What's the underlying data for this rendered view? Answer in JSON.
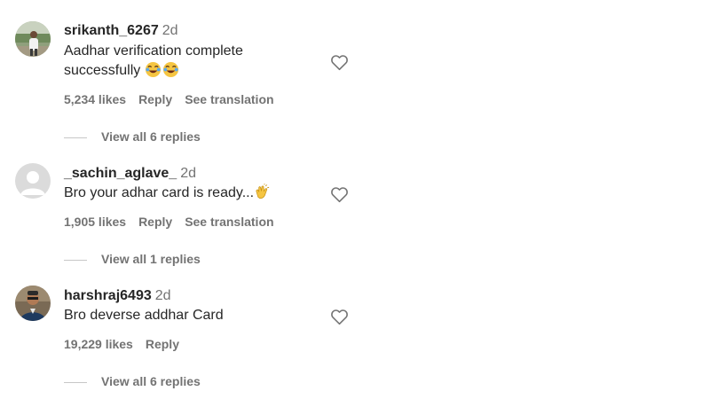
{
  "comments": [
    {
      "username": "srikanth_6267",
      "time": "2d",
      "text": "Aadhar verification complete successfully",
      "emoji": "😂😂",
      "likes": "5,234 likes",
      "reply_label": "Reply",
      "translation_label": "See translation",
      "view_replies": "View all 6 replies"
    },
    {
      "username": "_sachin_aglave_",
      "time": "2d",
      "text": "Bro your adhar card is ready...",
      "emoji": "👏",
      "likes": "1,905 likes",
      "reply_label": "Reply",
      "translation_label": "See translation",
      "view_replies": "View all 1 replies"
    },
    {
      "username": "harshraj6493",
      "time": "2d",
      "text": "Bro deverse addhar Card",
      "likes": "19,229 likes",
      "reply_label": "Reply",
      "view_replies": "View all 6 replies"
    }
  ],
  "icons": {
    "like": "heart-outline-icon",
    "default_avatar": "user-silhouette-icon"
  },
  "colors": {
    "username": "#262626",
    "secondary_text": "#737373",
    "divider": "#c7c7c7",
    "default_avatar_bg": "#dbdbdb"
  }
}
